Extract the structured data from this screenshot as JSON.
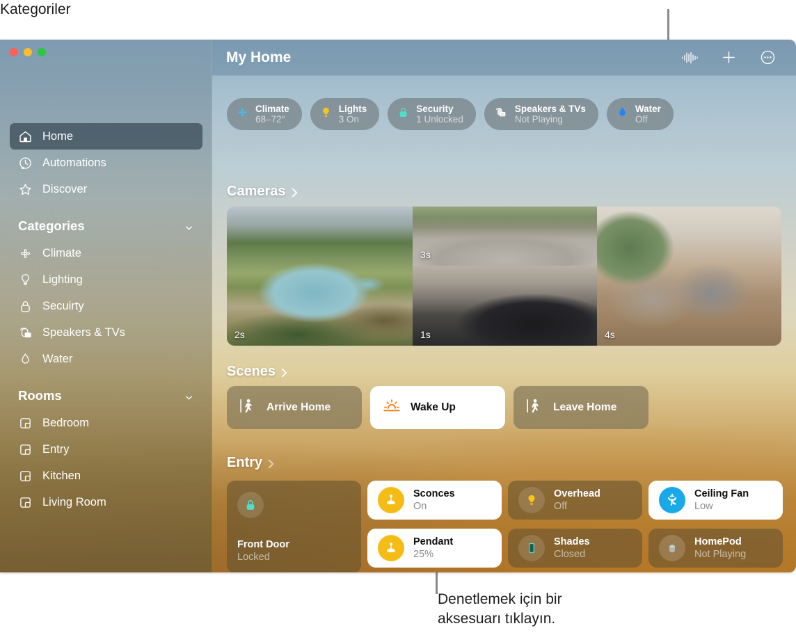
{
  "callouts": {
    "top": "Kategoriler",
    "bottom": "Denetlemek için bir\naksesuarı tıklayın."
  },
  "window": {
    "title": "My Home",
    "traffic_lights": [
      "close",
      "minimize",
      "zoom"
    ],
    "toolbar": [
      {
        "name": "waveform-icon",
        "label": "Siri"
      },
      {
        "name": "plus-icon",
        "label": "Add"
      },
      {
        "name": "more-icon",
        "label": "More"
      }
    ]
  },
  "sidebar": {
    "primary": [
      {
        "label": "Home",
        "icon": "home-icon",
        "selected": true
      },
      {
        "label": "Automations",
        "icon": "clock-icon",
        "selected": false
      },
      {
        "label": "Discover",
        "icon": "star-icon",
        "selected": false
      }
    ],
    "categories_header": "Categories",
    "categories": [
      {
        "label": "Climate",
        "icon": "fan-icon"
      },
      {
        "label": "Lighting",
        "icon": "bulb-icon"
      },
      {
        "label": "Secuirty",
        "icon": "lock-icon"
      },
      {
        "label": "Speakers & TVs",
        "icon": "speaker-tv-icon"
      },
      {
        "label": "Water",
        "icon": "droplet-icon"
      }
    ],
    "rooms_header": "Rooms",
    "rooms": [
      {
        "label": "Bedroom",
        "icon": "room-icon"
      },
      {
        "label": "Entry",
        "icon": "room-icon"
      },
      {
        "label": "Kitchen",
        "icon": "room-icon"
      },
      {
        "label": "Living Room",
        "icon": "room-icon"
      }
    ]
  },
  "chips": [
    {
      "title": "Climate",
      "status": "68–72°",
      "icon": "fan-icon",
      "color": "#4db8e8"
    },
    {
      "title": "Lights",
      "status": "3 On",
      "icon": "bulb-icon",
      "color": "#f5c518"
    },
    {
      "title": "Security",
      "status": "1 Unlocked",
      "icon": "lock-icon",
      "color": "#4ce0c8"
    },
    {
      "title": "Speakers & TVs",
      "status": "Not Playing",
      "icon": "speaker-tv-icon",
      "color": "#e8e8e8"
    },
    {
      "title": "Water",
      "status": "Off",
      "icon": "droplet-icon",
      "color": "#1f86f0"
    }
  ],
  "sections": {
    "cameras": "Cameras",
    "scenes": "Scenes",
    "entry": "Entry"
  },
  "cameras": [
    {
      "name": "pool-camera",
      "badge": "2s"
    },
    {
      "name": "driveway-camera",
      "badge": "3s"
    },
    {
      "name": "garage-camera",
      "badge": "1s"
    },
    {
      "name": "living-room-camera",
      "badge": "4s"
    }
  ],
  "scenes": [
    {
      "label": "Arrive Home",
      "icon": "walk-in-icon",
      "active": false
    },
    {
      "label": "Wake Up",
      "icon": "sunrise-icon",
      "active": true
    },
    {
      "label": "Leave Home",
      "icon": "walk-out-icon",
      "active": false
    }
  ],
  "accessories": [
    {
      "name": "Front Door",
      "status": "Locked",
      "icon": "lock-icon",
      "active": false,
      "size": "wide"
    },
    {
      "name": "Sconces",
      "status": "On",
      "icon": "sconce-icon",
      "active": true,
      "size": "small"
    },
    {
      "name": "Pendant",
      "status": "25%",
      "icon": "sconce-icon",
      "active": true,
      "size": "small"
    },
    {
      "name": "Overhead",
      "status": "Off",
      "icon": "bulb-icon",
      "active": false,
      "size": "small"
    },
    {
      "name": "Shades",
      "status": "Closed",
      "icon": "shade-icon",
      "active": false,
      "size": "small"
    },
    {
      "name": "Ceiling Fan",
      "status": "Low",
      "icon": "ceiling-fan-icon",
      "active": true,
      "size": "small"
    },
    {
      "name": "HomePod",
      "status": "Not Playing",
      "icon": "homepod-icon",
      "active": false,
      "size": "small"
    }
  ],
  "colors": {
    "accent_yellow": "#f5bc16",
    "accent_blue": "#19a8e8",
    "accent_teal": "#4ce0c8",
    "selected_nav": "#283945"
  }
}
